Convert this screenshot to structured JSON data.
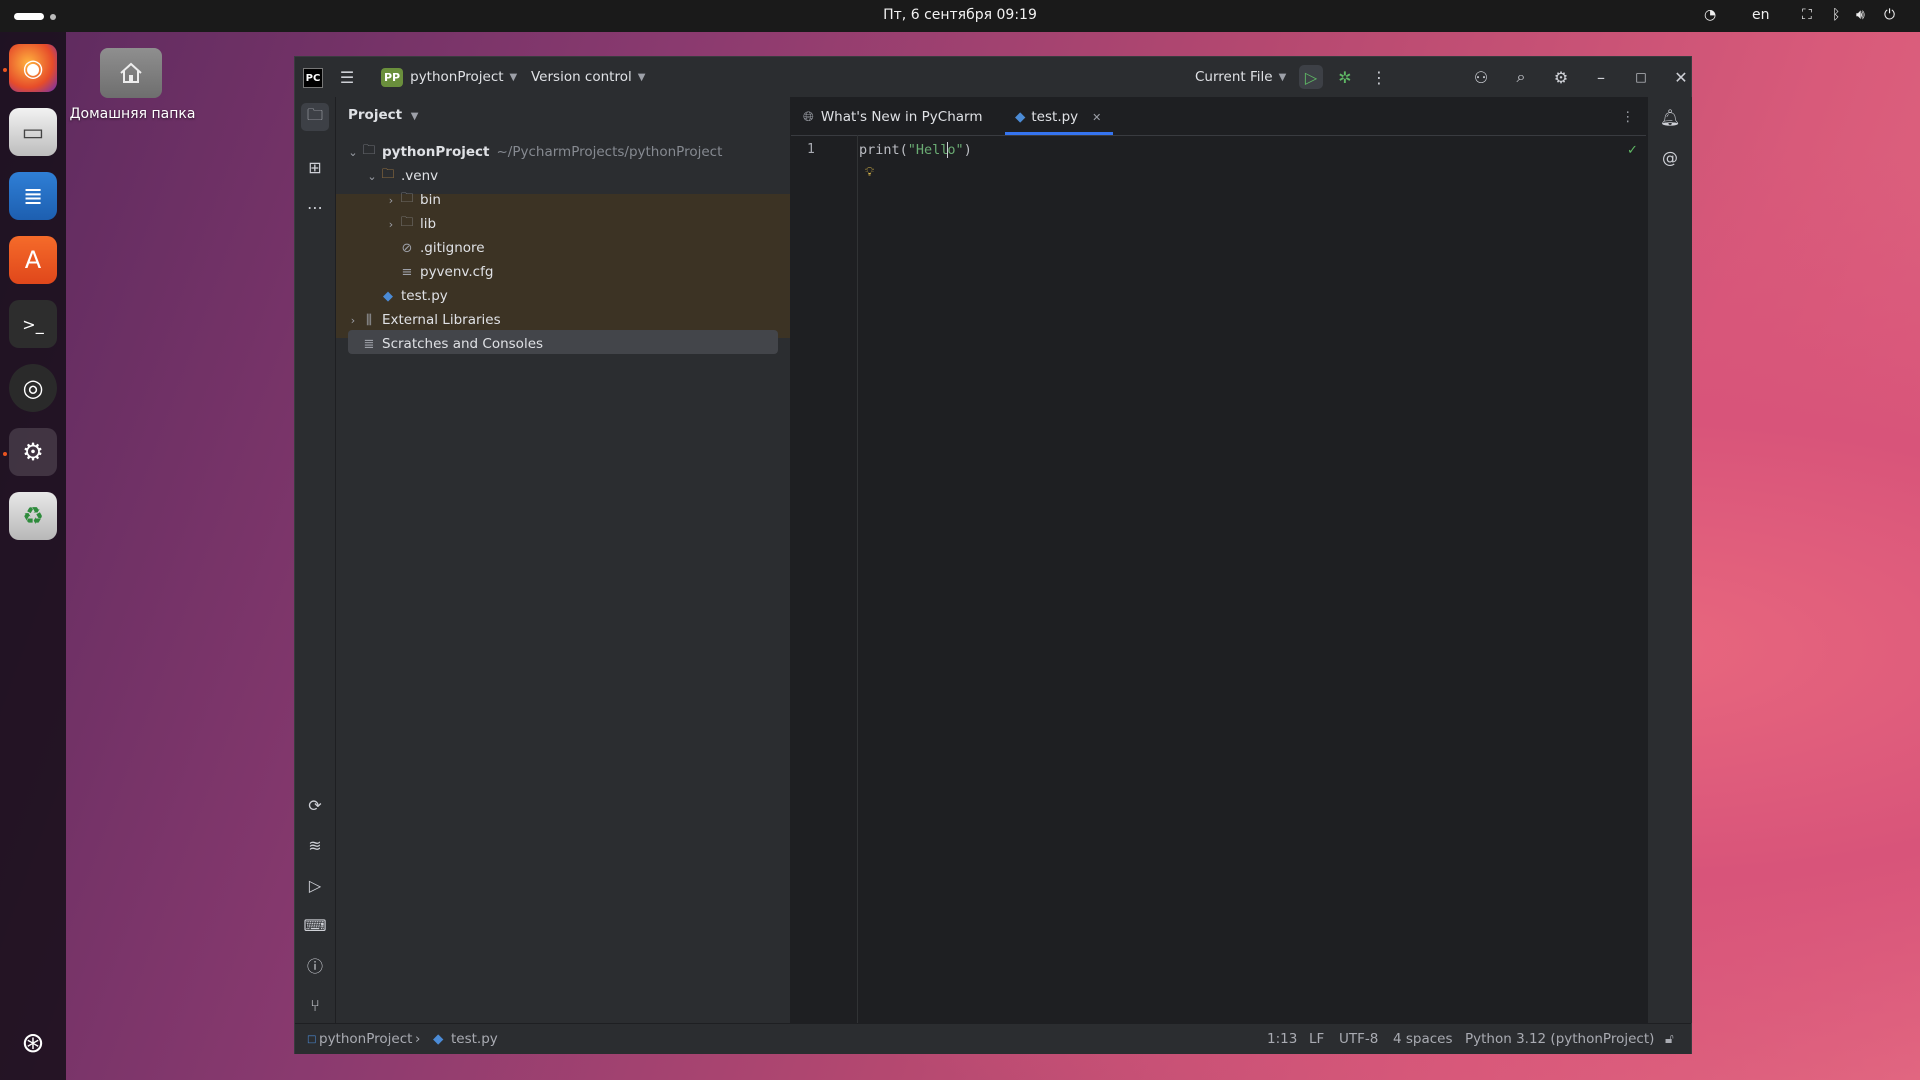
{
  "topbar": {
    "clock": "Пт, 6 сентября  09:19",
    "lang": "en"
  },
  "desktop": {
    "home_label": "Домашняя папка"
  },
  "dock": {
    "items": [
      "firefox-icon",
      "files-icon",
      "writer-icon",
      "app-center-icon",
      "terminal-icon",
      "obs-icon",
      "settings-icon",
      "trash-icon",
      "show-apps-icon"
    ]
  },
  "titlebar": {
    "project_badge": "PP",
    "project_name": "pythonProject",
    "vcs": "Version control",
    "run_config": "Current File"
  },
  "project_panel": {
    "header": "Project",
    "tree": [
      {
        "label": "pythonProject",
        "path": "~/PycharmProjects/pythonProject"
      },
      {
        "label": ".venv"
      },
      {
        "label": "bin"
      },
      {
        "label": "lib"
      },
      {
        "label": ".gitignore"
      },
      {
        "label": "pyvenv.cfg"
      },
      {
        "label": "test.py"
      },
      {
        "label": "External Libraries"
      },
      {
        "label": "Scratches and Consoles"
      }
    ]
  },
  "editor": {
    "tabs": [
      {
        "label": "What's New in PyCharm"
      },
      {
        "label": "test.py",
        "active": true
      }
    ],
    "line_number": "1",
    "code_prefix": "print(",
    "code_string_a": "\"Hell",
    "code_string_b": "o\"",
    "code_suffix": ")"
  },
  "statusbar": {
    "crumb_project": "pythonProject",
    "crumb_file": "test.py",
    "position": "1:13",
    "line_sep": "LF",
    "encoding": "UTF-8",
    "indent": "4 spaces",
    "interpreter": "Python 3.12 (pythonProject)"
  },
  "colors": {
    "accent": "#3574f0",
    "venv_highlight": "#3c3324",
    "run_green": "#5fb865",
    "string_green": "#6aab73"
  }
}
